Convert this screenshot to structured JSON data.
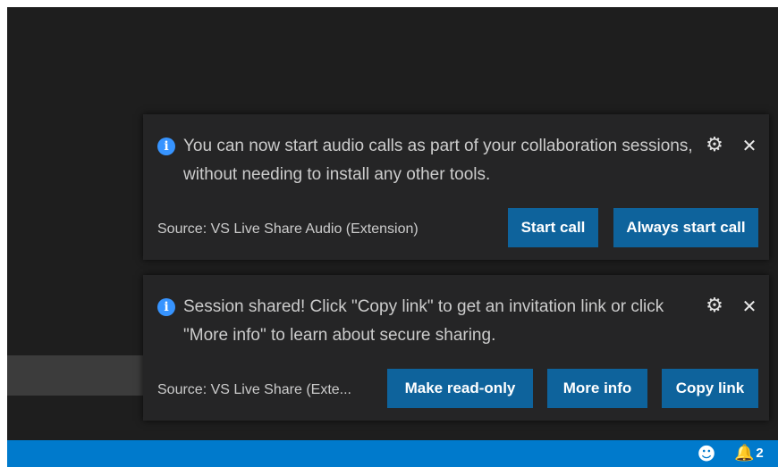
{
  "notifications": [
    {
      "message": "You can now start audio calls as part of your collaboration sessions, without needing to install any other tools.",
      "source": "Source: VS Live Share Audio (Extension)",
      "buttons": [
        "Start call",
        "Always start call"
      ]
    },
    {
      "message": "Session shared! Click \"Copy link\" to get an invitation link or click \"More info\" to learn about secure sharing.",
      "source": "Source: VS Live Share (Exte...",
      "buttons": [
        "Make read-only",
        "More info",
        "Copy link"
      ]
    }
  ],
  "icons": {
    "info": "i",
    "gear": "⚙",
    "close": "✕",
    "smiley": "☻",
    "bell": "🔔"
  },
  "statusbar": {
    "notification_count": "2"
  },
  "colors": {
    "editor_bg": "#1e1e1e",
    "toast_bg": "#252526",
    "button_bg": "#0e639c",
    "statusbar_bg": "#007acc",
    "info_blue": "#3794ff"
  }
}
